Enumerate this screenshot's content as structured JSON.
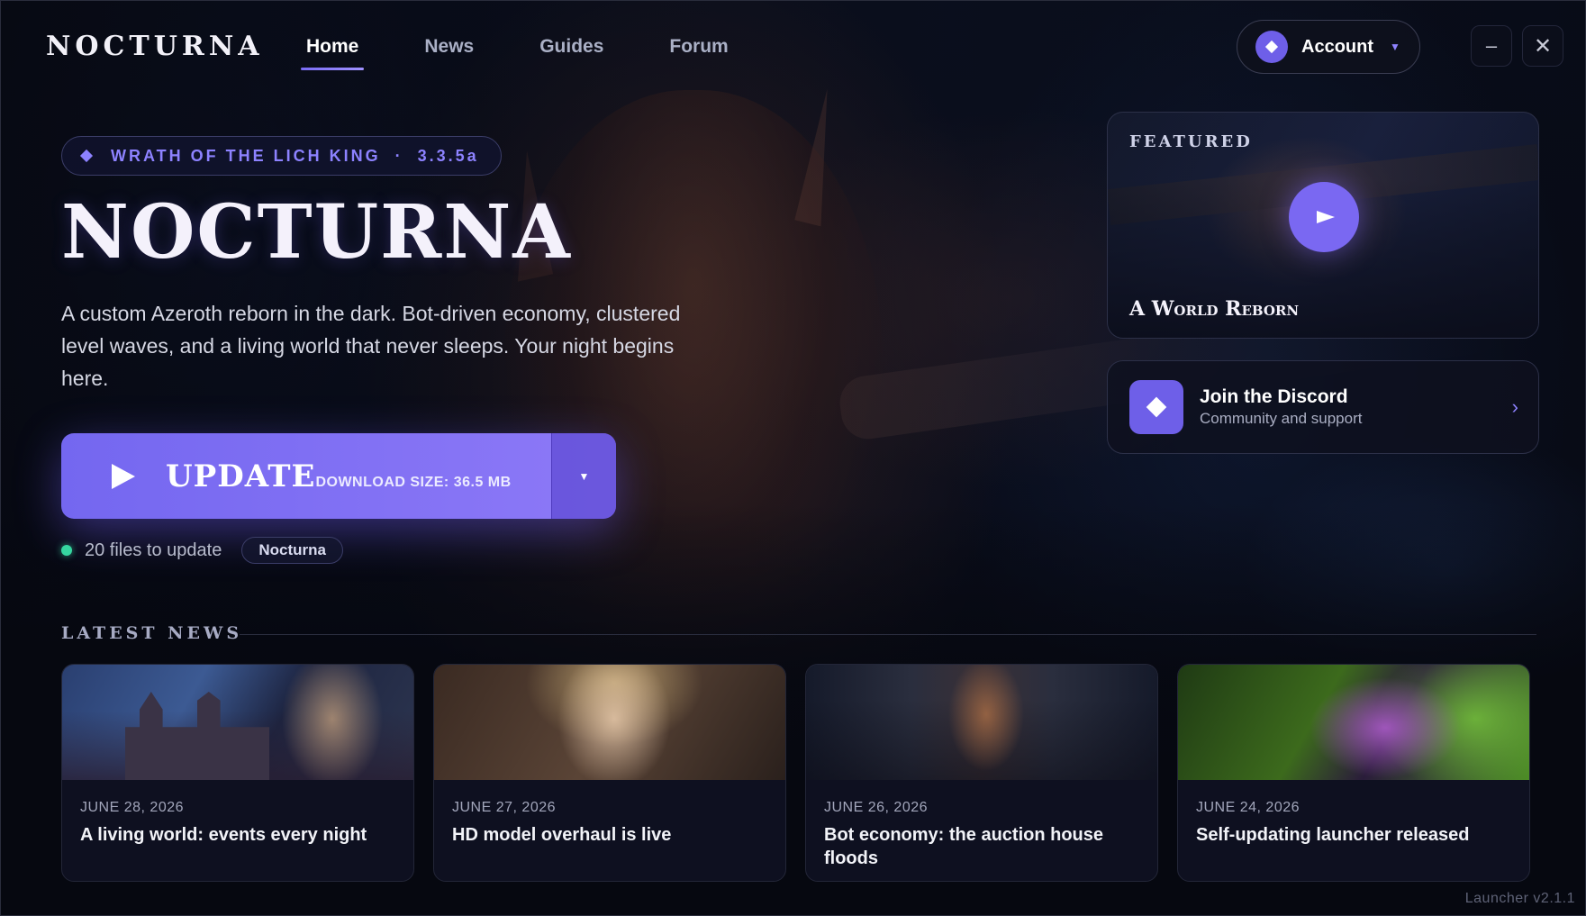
{
  "header": {
    "logo": "NOCTURNA",
    "nav": [
      {
        "label": "Home",
        "active": true
      },
      {
        "label": "News",
        "active": false
      },
      {
        "label": "Guides",
        "active": false
      },
      {
        "label": "Forum",
        "active": false
      }
    ],
    "account": {
      "label": "Account",
      "avatar_icon": "diamond-icon",
      "caret_icon": "caret-down-icon"
    },
    "window": {
      "minimize_icon": "minimize-icon",
      "close_icon": "close-icon"
    }
  },
  "hero": {
    "badge": {
      "expansion": "WRATH OF THE LICH KING",
      "separator": "·",
      "version": "3.3.5a"
    },
    "title": "NOCTURNA",
    "description": "A custom Azeroth reborn in the dark. Bot-driven economy, clustered level waves, and a living world that never sleeps. Your night begins here.",
    "update_button": {
      "label": "UPDATE",
      "size_label": "DOWNLOAD SIZE: 36.5 MB",
      "play_icon": "play-icon",
      "dropdown_icon": "caret-down-icon"
    },
    "status": {
      "text": "20 files to update",
      "realm": "Nocturna",
      "color": "#36d6a0"
    }
  },
  "featured": {
    "label": "FEATURED",
    "title": "A World Reborn",
    "play_icon": "play-icon"
  },
  "discord": {
    "title": "Join the Discord",
    "subtitle": "Community and support",
    "icon": "diamond-icon",
    "chevron_icon": "chevron-right-icon"
  },
  "news": {
    "heading": "LATEST NEWS",
    "items": [
      {
        "date": "JUNE 28, 2026",
        "title": "A living world: events every night"
      },
      {
        "date": "JUNE 27, 2026",
        "title": "HD model overhaul is live"
      },
      {
        "date": "JUNE 26, 2026",
        "title": "Bot economy: the auction house floods"
      },
      {
        "date": "JUNE 24, 2026",
        "title": "Self-updating launcher released"
      }
    ]
  },
  "footer": {
    "version": "Launcher v2.1.1"
  },
  "colors": {
    "accent": "#7467f0",
    "accent_light": "#8d82ff",
    "background": "#07080f"
  }
}
